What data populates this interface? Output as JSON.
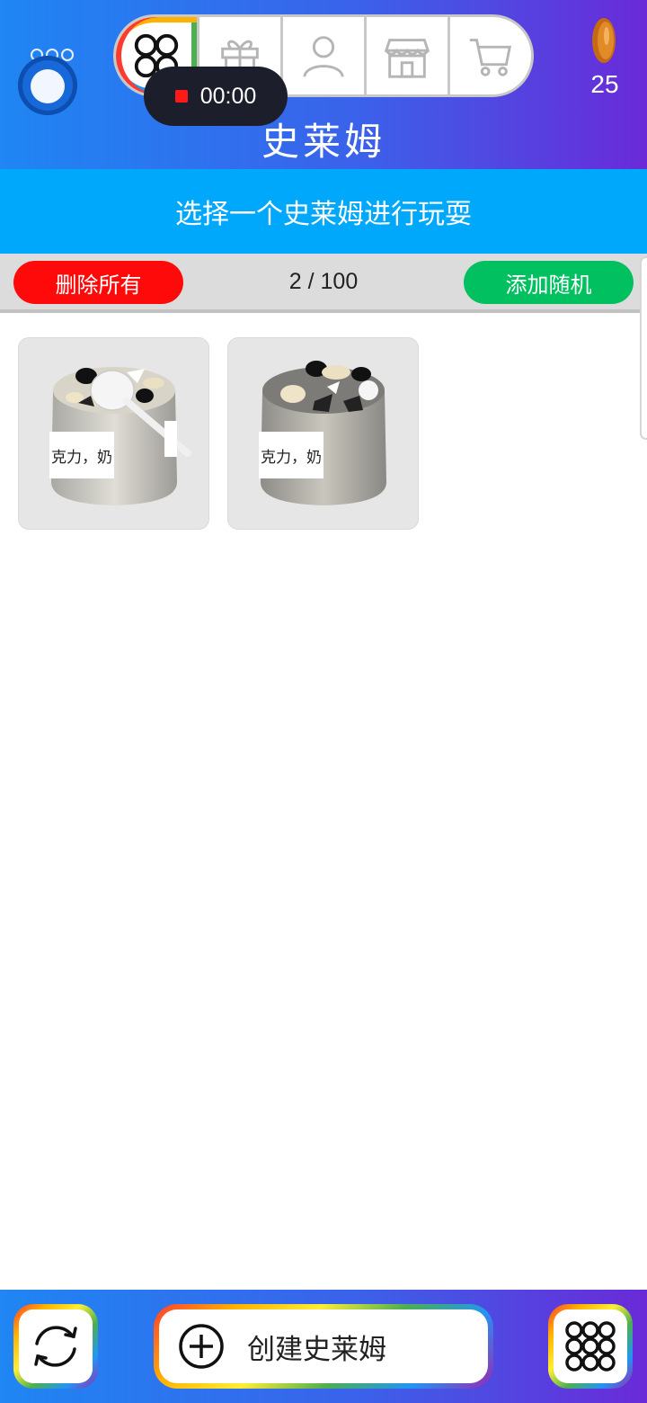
{
  "header": {
    "title": "史莱姆",
    "coins": "25",
    "record_time": "00:00",
    "nav_tabs": [
      {
        "name": "slimes",
        "icon": "four-circles-icon",
        "active": true
      },
      {
        "name": "gifts",
        "icon": "gift-icon",
        "active": false
      },
      {
        "name": "profile",
        "icon": "user-icon",
        "active": false
      },
      {
        "name": "shop",
        "icon": "store-icon",
        "active": false
      },
      {
        "name": "cart",
        "icon": "cart-icon",
        "active": false
      }
    ]
  },
  "instruction": "选择一个史莱姆进行玩耍",
  "actions": {
    "delete_all": "删除所有",
    "count": "2 / 100",
    "add_random": "添加随机"
  },
  "slimes": [
    {
      "label": "克力，奶"
    },
    {
      "label": "克力，奶"
    }
  ],
  "footer": {
    "create_label": "创建史莱姆"
  },
  "colors": {
    "header_gradient_start": "#1f86f3",
    "header_gradient_end": "#6a2ad8",
    "instruction_bg": "#00a8fb",
    "delete_button": "#ff0a0a",
    "random_button": "#00c060"
  }
}
